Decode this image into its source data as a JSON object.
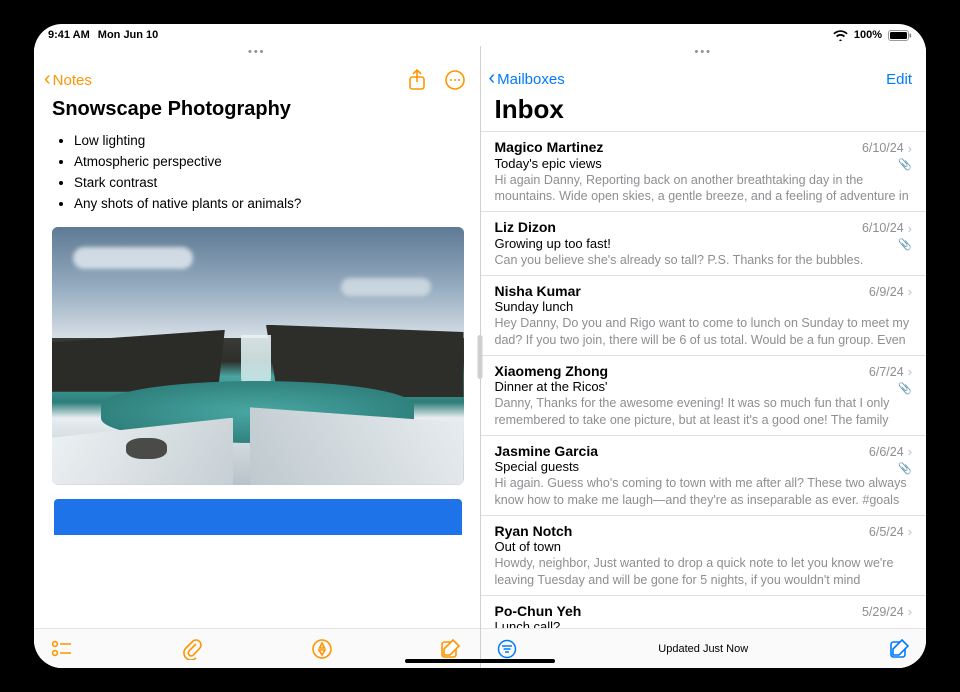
{
  "statusbar": {
    "time": "9:41 AM",
    "date": "Mon Jun 10",
    "battery": "100%"
  },
  "notes": {
    "back_label": "Notes",
    "title": "Snowscape Photography",
    "bullets": [
      "Low lighting",
      "Atmospheric perspective",
      "Stark contrast",
      "Any shots of native plants or animals?"
    ]
  },
  "mail": {
    "back_label": "Mailboxes",
    "edit_label": "Edit",
    "title": "Inbox",
    "status": "Updated Just Now",
    "items": [
      {
        "sender": "Magico Martinez",
        "date": "6/10/24",
        "subject": "Today's epic views",
        "preview": "Hi again Danny, Reporting back on another breathtaking day in the mountains. Wide open skies, a gentle breeze, and a feeling of adventure in the air. I felt l…",
        "attachment": true
      },
      {
        "sender": "Liz Dizon",
        "date": "6/10/24",
        "subject": "Growing up too fast!",
        "preview": "Can you believe she's already so tall? P.S. Thanks for the bubbles.",
        "attachment": true
      },
      {
        "sender": "Nisha Kumar",
        "date": "6/9/24",
        "subject": "Sunday lunch",
        "preview": "Hey Danny, Do you and Rigo want to come to lunch on Sunday to meet my dad? If you two join, there will be 6 of us total. Would be a fun group. Even if…",
        "attachment": false
      },
      {
        "sender": "Xiaomeng Zhong",
        "date": "6/7/24",
        "subject": "Dinner at the Ricos'",
        "preview": "Danny, Thanks for the awesome evening! It was so much fun that I only remembered to take one picture, but at least it's a good one! The family and…",
        "attachment": true
      },
      {
        "sender": "Jasmine Garcia",
        "date": "6/6/24",
        "subject": "Special guests",
        "preview": "Hi again. Guess who's coming to town with me after all? These two always know how to make me laugh—and they're as inseparable as ever. #goals",
        "attachment": true
      },
      {
        "sender": "Ryan Notch",
        "date": "6/5/24",
        "subject": "Out of town",
        "preview": "Howdy, neighbor, Just wanted to drop a quick note to let you know we're leaving Tuesday and will be gone for 5 nights, if you wouldn't mind keeping…",
        "attachment": false
      },
      {
        "sender": "Po-Chun Yeh",
        "date": "5/29/24",
        "subject": "Lunch call?",
        "preview": "",
        "attachment": false
      }
    ]
  }
}
